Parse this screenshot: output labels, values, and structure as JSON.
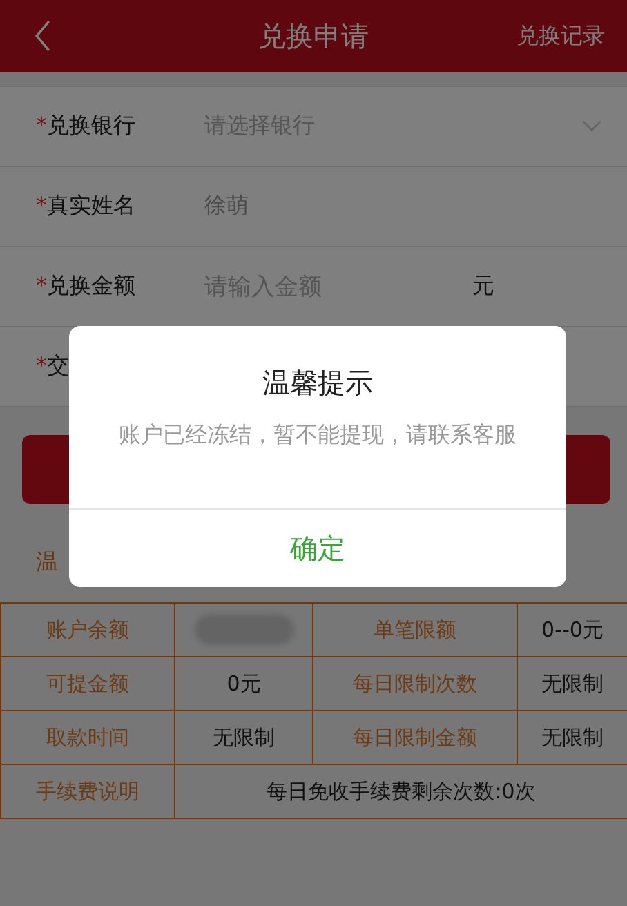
{
  "header": {
    "title": "兑换申请",
    "action": "兑换记录"
  },
  "form": {
    "rows": [
      {
        "required_mark": "*",
        "label": "兑换银行",
        "kind": "select",
        "placeholder": "请选择银行"
      },
      {
        "required_mark": "*",
        "label": "真实姓名",
        "kind": "text",
        "value": "徐萌"
      },
      {
        "required_mark": "*",
        "label": "兑换金额",
        "kind": "amount",
        "placeholder": "请输入金额",
        "unit": "元"
      },
      {
        "required_mark": "*",
        "label": "交",
        "kind": "covered"
      }
    ]
  },
  "tips_heading": "温",
  "table": {
    "rows": [
      [
        {
          "kind": "label",
          "text": "账户余额"
        },
        {
          "kind": "blurred"
        },
        {
          "kind": "label",
          "text": "单笔限额"
        },
        {
          "kind": "value",
          "text": "0--0元"
        }
      ],
      [
        {
          "kind": "label",
          "text": "可提金额"
        },
        {
          "kind": "value",
          "text": "0元"
        },
        {
          "kind": "label",
          "text": "每日限制次数"
        },
        {
          "kind": "value",
          "text": "无限制"
        }
      ],
      [
        {
          "kind": "label",
          "text": "取款时间"
        },
        {
          "kind": "value",
          "text": "无限制"
        },
        {
          "kind": "label",
          "text": "每日限制金额"
        },
        {
          "kind": "value",
          "text": "无限制"
        }
      ],
      [
        {
          "kind": "label",
          "text": "手续费说明"
        },
        {
          "kind": "wide",
          "text": "每日免收手续费剩余次数:0次"
        }
      ]
    ]
  },
  "dialog": {
    "title": "温馨提示",
    "message": "账户已经冻结，暂不能提现，请联系客服",
    "button": "确定"
  }
}
